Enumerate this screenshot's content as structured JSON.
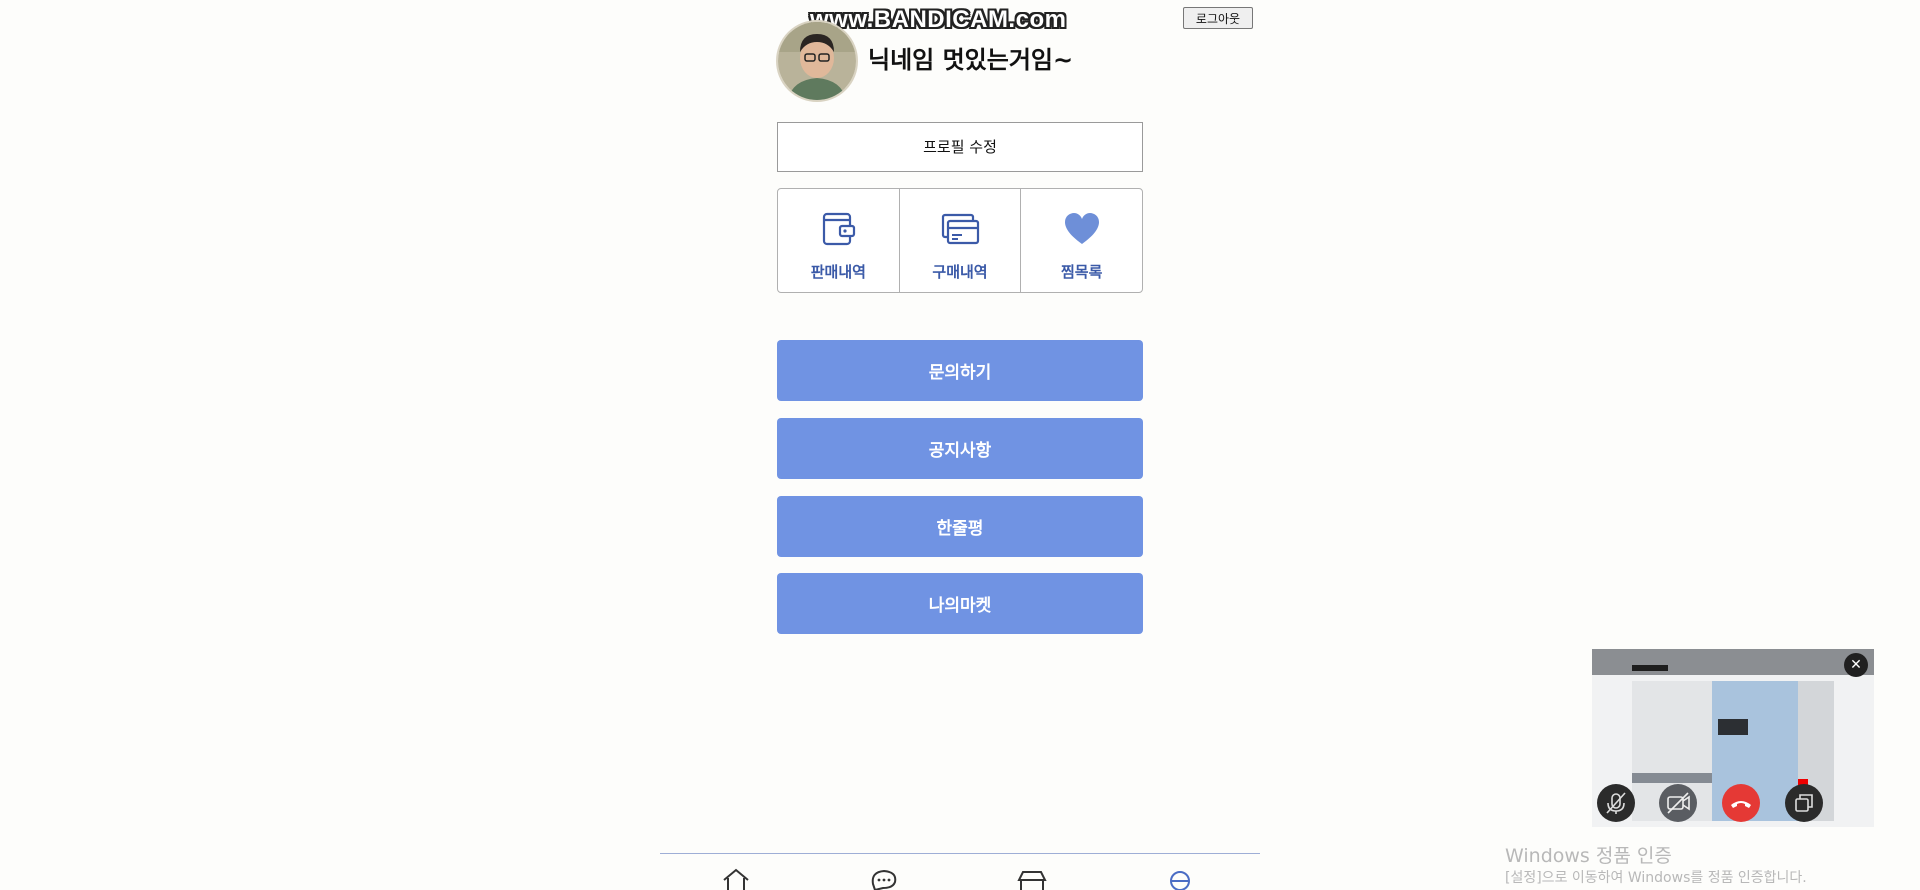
{
  "watermark": "www.BANDICAM.com",
  "header": {
    "logout_label": "로그아웃",
    "nickname": "닉네임 멋있는거임~"
  },
  "profile": {
    "edit_label": "프로필 수정"
  },
  "quick_menu": [
    {
      "label": "판매내역",
      "icon": "wallet-icon"
    },
    {
      "label": "구매내역",
      "icon": "cards-icon"
    },
    {
      "label": "찜목록",
      "icon": "heart-icon"
    }
  ],
  "menu_buttons": [
    {
      "label": "문의하기"
    },
    {
      "label": "공지사항"
    },
    {
      "label": "한줄평"
    },
    {
      "label": "나의마켓"
    }
  ],
  "bottom_nav": [
    {
      "icon": "home-icon"
    },
    {
      "icon": "chat-icon"
    },
    {
      "icon": "shop-icon"
    },
    {
      "icon": "profile-icon"
    }
  ],
  "windows_activation": {
    "title": "Windows 정품 인증",
    "subtitle": "[설정]으로 이동하여 Windows를 정품 인증합니다."
  },
  "colors": {
    "accent": "#7093e3",
    "accent_text": "#3b5aa8",
    "end_call": "#e53935"
  }
}
